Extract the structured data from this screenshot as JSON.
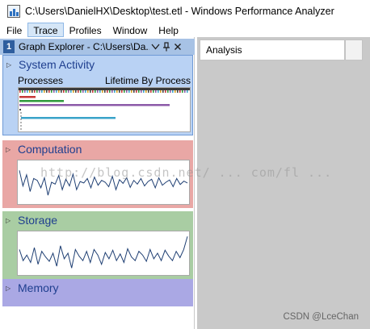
{
  "window": {
    "title": "C:\\Users\\DanielHX\\Desktop\\test.etl - Windows Performance Analyzer",
    "icon": "performance-analyzer-icon"
  },
  "menu": {
    "items": [
      "File",
      "Trace",
      "Profiles",
      "Window",
      "Help"
    ],
    "active": "Trace"
  },
  "graph_explorer": {
    "number": "1",
    "title": "Graph Explorer - C:\\Users\\Da...",
    "buttons": [
      "dropdown-icon",
      "pin-icon",
      "close-icon"
    ],
    "sections": [
      {
        "id": "system-activity",
        "title": "System Activity",
        "subtitle_left": "Processes",
        "subtitle_right": "Lifetime By Process",
        "color": "#b9d2f4"
      },
      {
        "id": "computation",
        "title": "Computation",
        "color": "#e9a7a5"
      },
      {
        "id": "storage",
        "title": "Storage",
        "color": "#a9cda3"
      },
      {
        "id": "memory",
        "title": "Memory",
        "color": "#aaa8e4"
      }
    ]
  },
  "analysis": {
    "tab_label": "Analysis"
  },
  "overlay": {
    "watermark": "http://blog.csdn.net/ ... com/fl ...  ",
    "credit": "CSDN @LceChan"
  },
  "graphs": {
    "computation": [
      0.82,
      0.4,
      0.7,
      0.25,
      0.6,
      0.55,
      0.35,
      0.62,
      0.15,
      0.5,
      0.45,
      0.68,
      0.3,
      0.58,
      0.4,
      0.72,
      0.3,
      0.52,
      0.48,
      0.6,
      0.35,
      0.64,
      0.42,
      0.55,
      0.5,
      0.38,
      0.66,
      0.3,
      0.57,
      0.47,
      0.62,
      0.36,
      0.55,
      0.45,
      0.6,
      0.4,
      0.52,
      0.58,
      0.35,
      0.62,
      0.42,
      0.5,
      0.56,
      0.38,
      0.6,
      0.44,
      0.53,
      0.48
    ],
    "storage": [
      0.6,
      0.3,
      0.45,
      0.25,
      0.65,
      0.2,
      0.55,
      0.4,
      0.28,
      0.5,
      0.15,
      0.7,
      0.35,
      0.5,
      0.1,
      0.6,
      0.42,
      0.3,
      0.55,
      0.25,
      0.6,
      0.45,
      0.2,
      0.52,
      0.35,
      0.58,
      0.3,
      0.48,
      0.25,
      0.62,
      0.4,
      0.3,
      0.55,
      0.45,
      0.28,
      0.6,
      0.35,
      0.5,
      0.3,
      0.58,
      0.42,
      0.3,
      0.55,
      0.38,
      0.6,
      0.95
    ]
  }
}
